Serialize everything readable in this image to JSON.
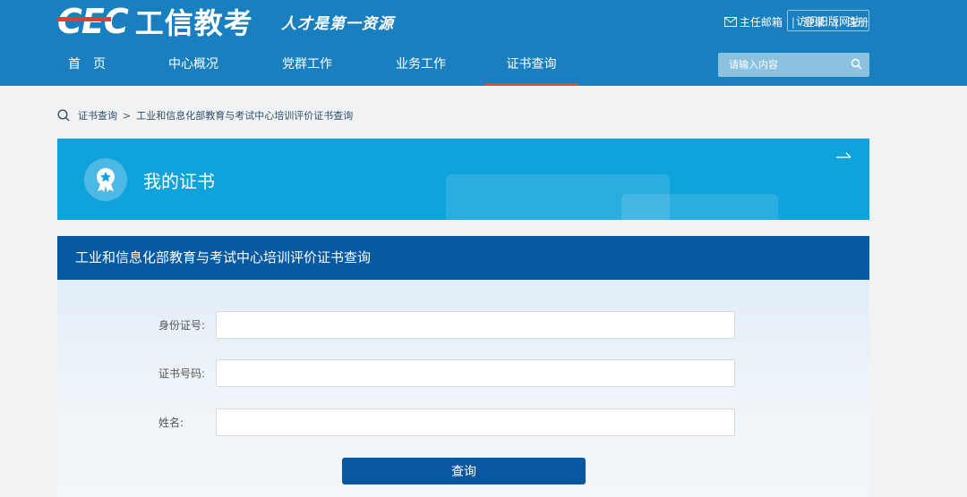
{
  "header": {
    "logo_mark": "CEC",
    "logo_name": "工信教考",
    "slogan": "人才是第一资源",
    "mail_label": "主任邮箱",
    "login_label": "登录",
    "register_label": "注册",
    "old_site_label": "访问旧版网站",
    "separator": "|"
  },
  "nav": {
    "items": [
      {
        "label": "首　页"
      },
      {
        "label": "中心概况"
      },
      {
        "label": "党群工作"
      },
      {
        "label": "业务工作"
      },
      {
        "label": "证书查询",
        "active": true
      }
    ]
  },
  "search": {
    "placeholder": "请输入内容"
  },
  "breadcrumb": {
    "root": "证书查询",
    "arrow": ">",
    "current": "工业和信息化部教育与考试中心培训评价证书查询"
  },
  "banner": {
    "title": "我的证书"
  },
  "form": {
    "title": "工业和信息化部教育与考试中心培训评价证书查询",
    "fields": [
      {
        "label": "身份证号:",
        "value": ""
      },
      {
        "label": "证书号码:",
        "value": ""
      },
      {
        "label": "姓名:",
        "value": ""
      }
    ],
    "submit_label": "查询"
  },
  "colors": {
    "header_bg": "#1a7fbf",
    "nav_active": "#e8434b",
    "banner_bg": "#0fa2db",
    "form_header_bg": "#075aa1",
    "button_bg": "#0b56a0"
  }
}
